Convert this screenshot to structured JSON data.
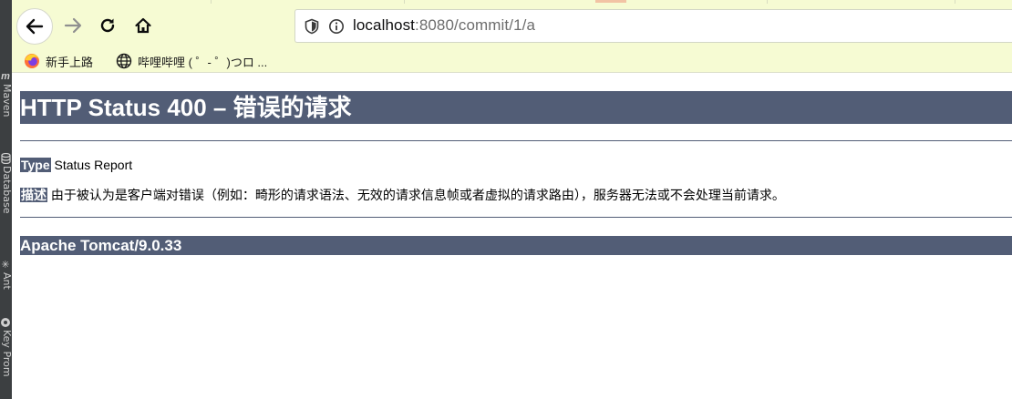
{
  "ide": {
    "tabs": [
      {
        "label": "Maven",
        "icon": "maven-icon"
      },
      {
        "label": "Database",
        "icon": "database-icon"
      },
      {
        "label": "Ant",
        "icon": "ant-icon"
      },
      {
        "label": "Key Prom",
        "icon": "key-promoter-icon"
      }
    ]
  },
  "browser": {
    "url_host": "localhost",
    "url_rest": ":8080/commit/1/a",
    "icons": {
      "back": "back-arrow-icon",
      "forward": "forward-arrow-icon",
      "reload": "reload-icon",
      "home": "home-icon",
      "shield": "tracking-shield-icon",
      "info": "site-info-icon"
    },
    "bookmarks": [
      {
        "label": "新手上路",
        "icon": "firefox-icon"
      },
      {
        "label": "哔哩哔哩 ( ゜- ゜)つロ ...",
        "icon": "globe-icon"
      }
    ]
  },
  "page": {
    "title": "HTTP Status 400 – 错误的请求",
    "type_label": "Type",
    "type_value": "Status Report",
    "desc_label": "描述",
    "desc_value": "由于被认为是客户端对错误（例如：畸形的请求语法、无效的请求信息帧或者虚拟的请求路由），服务器无法或不会处理当前请求。",
    "server": "Apache Tomcat/9.0.33"
  },
  "colors": {
    "tomcat_header": "#525d76",
    "chrome_bg": "#f6fbd3"
  }
}
